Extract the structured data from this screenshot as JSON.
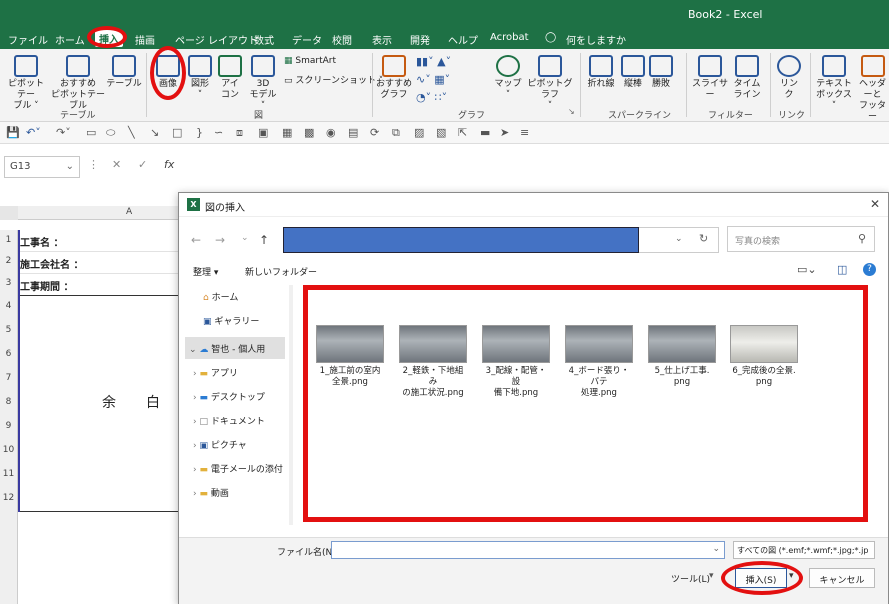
{
  "window": {
    "title": "Book2  -  Excel"
  },
  "menu": {
    "items": [
      "ファイル",
      "ホーム",
      "挿入",
      "描画",
      "ページ レイアウト",
      "数式",
      "データ",
      "校閲",
      "表示",
      "開発",
      "ヘルプ",
      "Acrobat",
      "何をしますか"
    ],
    "active": "挿入"
  },
  "ribbon": {
    "pivot": "ピボットテー\nブル ˅",
    "recommended_pivot": "おすすめ\nピボットテーブル",
    "table": "テーブル",
    "picture": "画像",
    "shapes": "図形\n˅",
    "icons": "アイ\nコン",
    "model3d": "3D\nモデル ˅",
    "smartart": "SmartArt",
    "screenshot": "スクリーンショット ˅",
    "recommended_charts": "おすすめ\nグラフ",
    "maps": "マップ\n˅",
    "pivot_chart": "ピボットグラフ\n˅",
    "line": "折れ線",
    "column": "縦棒",
    "winloss": "勝敗",
    "slicer": "スライサー",
    "timeline": "タイム\nライン",
    "link": "リン\nク",
    "textbox": "テキスト\nボックス ˅",
    "header": "ヘッダーと\nフッター",
    "groups": {
      "tables": "テーブル",
      "illustrations": "図",
      "charts": "グラフ",
      "sparklines": "スパークライン",
      "filters": "フィルター",
      "links": "リンク"
    }
  },
  "formula_bar": {
    "name_box": "G13",
    "fx": "fx"
  },
  "sheet": {
    "column": "A",
    "rows": [
      "1",
      "2",
      "3",
      "4",
      "5",
      "6",
      "7",
      "8",
      "9",
      "10",
      "11",
      "12"
    ],
    "a1": "工事名 ：",
    "a2": "施工会社名 ：",
    "a3": "工事期間 ：",
    "margin_text_1": "余",
    "margin_text_2": "白"
  },
  "dialog": {
    "title": "図の挿入",
    "search_placeholder": "写真の検索",
    "organize": "整理 ▾",
    "new_folder": "新しいフォルダー",
    "sidebar": [
      {
        "label": "ホーム",
        "icon": "home-icon"
      },
      {
        "label": "ギャラリー",
        "icon": "gallery-icon"
      },
      {
        "label": "智也 - 個人用",
        "icon": "cloud-icon"
      },
      {
        "label": "アプリ",
        "icon": "folder-icon"
      },
      {
        "label": "デスクトップ",
        "icon": "desktop-icon"
      },
      {
        "label": "ドキュメント",
        "icon": "document-icon"
      },
      {
        "label": "ピクチャ",
        "icon": "pictures-icon"
      },
      {
        "label": "電子メールの添付",
        "icon": "folder-icon"
      },
      {
        "label": "動画",
        "icon": "folder-icon"
      }
    ],
    "files": [
      {
        "name": "1_施工前の室内\n全景.png"
      },
      {
        "name": "2_軽鉄・下地組み\nの施工状況.png"
      },
      {
        "name": "3_配線・配管・設\n備下地.png"
      },
      {
        "name": "4_ボード張り・パテ\n処理.png"
      },
      {
        "name": "5_仕上げ工事.\npng"
      },
      {
        "name": "6_完成後の全景.\npng"
      }
    ],
    "filename_label": "ファイル名(N):",
    "filename_value": "",
    "filetype": "すべての図 (*.emf;*.wmf;*.jpg;*.jp",
    "tools": "ツール(L)",
    "insert": "挿入(S)",
    "cancel": "キャンセル"
  },
  "colors": {
    "excel_green": "#1e7145",
    "highlight_red": "#e31010",
    "address_blue": "#4472c4"
  }
}
